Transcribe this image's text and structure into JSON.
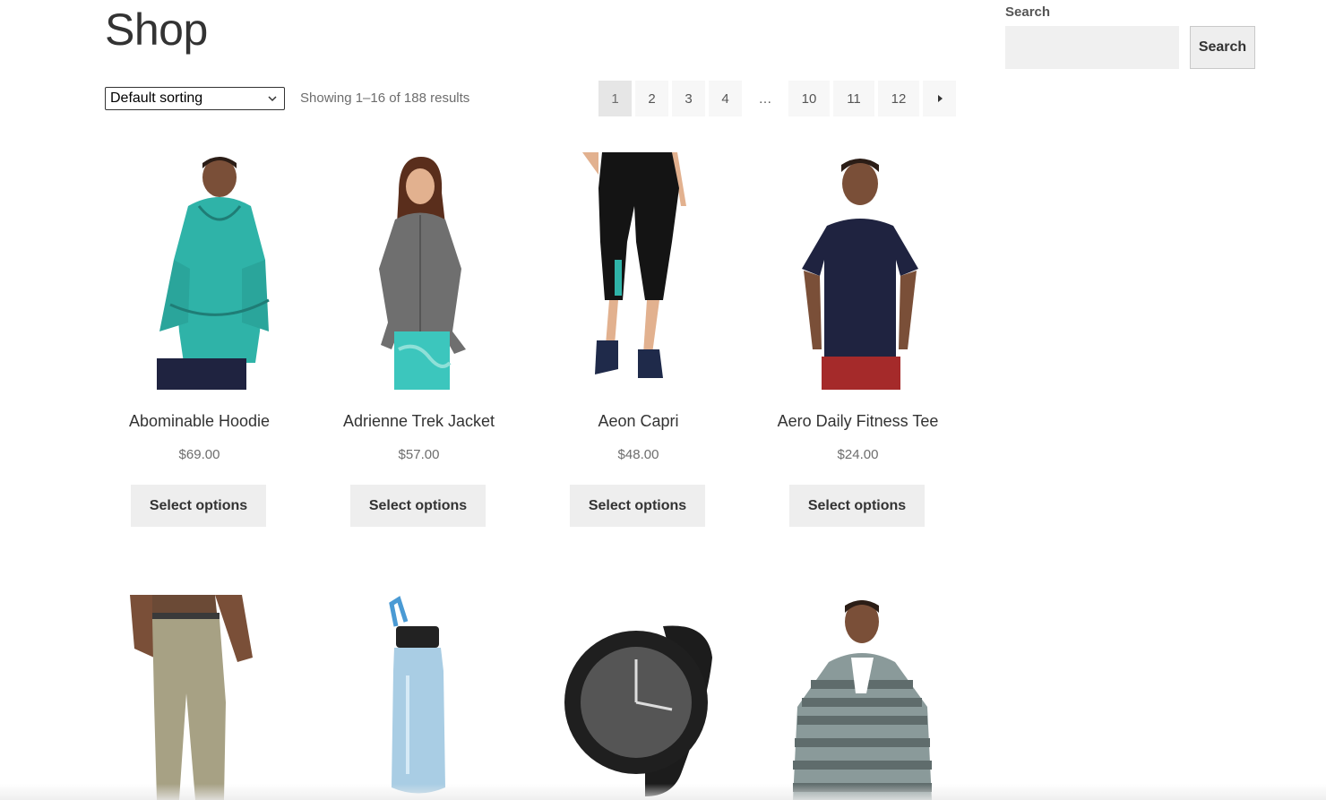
{
  "page": {
    "title": "Shop"
  },
  "toolbar": {
    "sort_value": "Default sorting",
    "result_count": "Showing 1–16 of 188 results"
  },
  "pagination": {
    "pages": [
      "1",
      "2",
      "3",
      "4",
      "…",
      "10",
      "11",
      "12"
    ],
    "current": "1",
    "next_icon": "caret-right-icon"
  },
  "search": {
    "label": "Search",
    "placeholder": "",
    "value": "",
    "button_label": "Search"
  },
  "products": [
    {
      "name": "Abominable Hoodie",
      "price": "$69.00",
      "button": "Select options",
      "image": "man-teal-hoodie"
    },
    {
      "name": "Adrienne Trek Jacket",
      "price": "$57.00",
      "button": "Select options",
      "image": "woman-gray-jacket"
    },
    {
      "name": "Aeon Capri",
      "price": "$48.00",
      "button": "Select options",
      "image": "black-capri-legs"
    },
    {
      "name": "Aero Daily Fitness Tee",
      "price": "$24.00",
      "button": "Select options",
      "image": "man-navy-tee"
    }
  ],
  "products_row2": [
    {
      "image": "khaki-pants"
    },
    {
      "image": "water-bottle"
    },
    {
      "image": "black-watch"
    },
    {
      "image": "man-striped-hoodie"
    }
  ],
  "colors": {
    "button_bg": "#eeeeee",
    "page_current_bg": "#e6e6e6",
    "page_bg": "#f7f7f7",
    "teal": "#2fb3a8",
    "navy": "#1f2340"
  }
}
